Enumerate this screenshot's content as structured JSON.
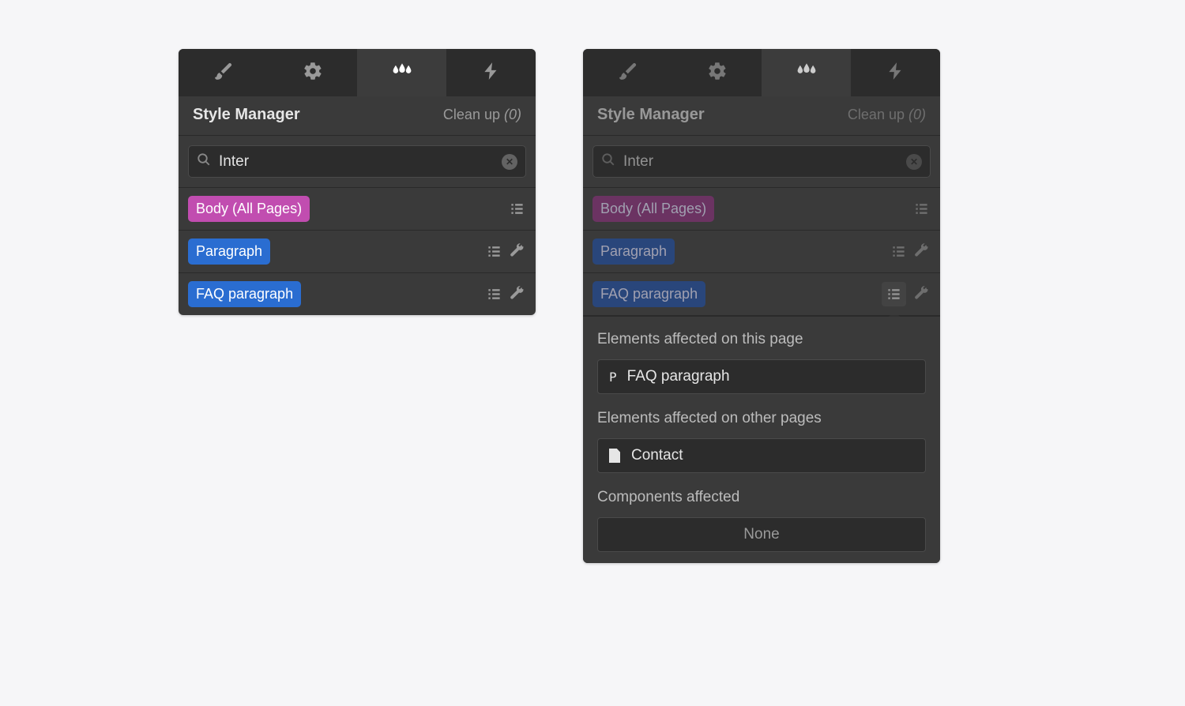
{
  "header": {
    "title": "Style Manager",
    "cleanup_label": "Clean up",
    "cleanup_count": "(0)"
  },
  "search": {
    "value": "Inter"
  },
  "styles": [
    {
      "label": "Body (All Pages)",
      "color": "purple",
      "has_wrench": false
    },
    {
      "label": "Paragraph",
      "color": "blue1",
      "has_wrench": true
    },
    {
      "label": "FAQ paragraph",
      "color": "blue2",
      "has_wrench": true
    }
  ],
  "popover": {
    "section1_label": "Elements affected on this page",
    "section1_item": "FAQ paragraph",
    "section2_label": "Elements affected on other pages",
    "section2_item": "Contact",
    "section3_label": "Components affected",
    "none_label": "None"
  },
  "tabs": [
    {
      "name": "brush",
      "active": false
    },
    {
      "name": "gear",
      "active": false
    },
    {
      "name": "drops",
      "active": true
    },
    {
      "name": "bolt",
      "active": false
    }
  ]
}
